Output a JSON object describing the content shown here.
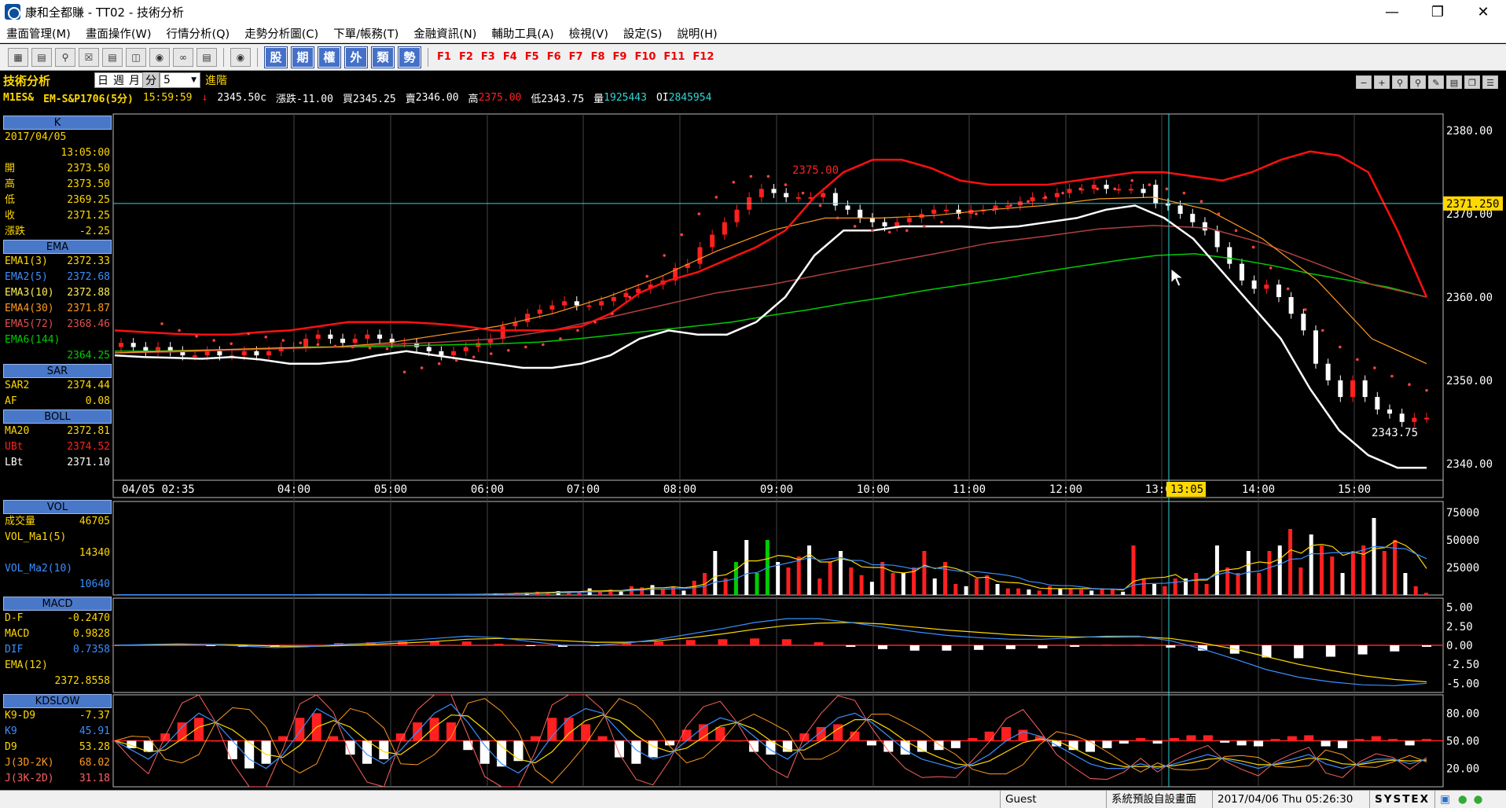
{
  "window": {
    "title": "康和全都賺 - TT02 - 技術分析"
  },
  "menu": [
    "畫面管理(M)",
    "畫面操作(W)",
    "行情分析(Q)",
    "走勢分析圖(C)",
    "下單/帳務(T)",
    "金融資訊(N)",
    "輔助工具(A)",
    "檢視(V)",
    "設定(S)",
    "說明(H)"
  ],
  "toolbar": {
    "kbuttons": [
      "股",
      "期",
      "權",
      "外",
      "類",
      "勢"
    ],
    "fkeys": [
      "F1",
      "F2",
      "F3",
      "F4",
      "F5",
      "F6",
      "F7",
      "F8",
      "F9",
      "F10",
      "F11",
      "F12"
    ]
  },
  "header": {
    "label": "技術分析",
    "periods": [
      "日",
      "週",
      "月",
      "分"
    ],
    "interval": "5",
    "advance": "進階"
  },
  "quote": {
    "symbol": "M1ES&",
    "name": "EM-S&P1706(5分)",
    "time": "15:59:59",
    "last": "2345.50c",
    "change": "漲跌-11.00",
    "bid": "買2345.25",
    "ask_label": "賣",
    "ask": "2346.00",
    "high_label": "高",
    "high": "2375.00",
    "low": "低2343.75",
    "vol_label": "量",
    "vol": "1925443",
    "oi_label": "OI",
    "oi": "2845954"
  },
  "panel": {
    "k": {
      "title": "K",
      "date": "2017/04/05",
      "time": "13:05:00",
      "rows": [
        [
          "開",
          "2373.50"
        ],
        [
          "高",
          "2373.50"
        ],
        [
          "低",
          "2369.25"
        ],
        [
          "收",
          "2371.25"
        ],
        [
          "漲跌",
          "-2.25"
        ]
      ]
    },
    "ema": {
      "title": "EMA",
      "rows": [
        [
          "EMA1(3)",
          "2372.33"
        ],
        [
          "EMA2(5)",
          "2372.68"
        ],
        [
          "EMA3(10)",
          "2372.88"
        ],
        [
          "EMA4(30)",
          "2371.87"
        ],
        [
          "EMA5(72)",
          "2368.46"
        ],
        [
          "EMA6(144)",
          ""
        ],
        [
          "",
          "2364.25"
        ]
      ]
    },
    "sar": {
      "title": "SAR",
      "rows": [
        [
          "SAR2",
          "2374.44"
        ],
        [
          "AF",
          "0.08"
        ]
      ]
    },
    "boll": {
      "title": "BOLL",
      "rows": [
        [
          "MA20",
          "2372.81"
        ],
        [
          "UBt",
          "2374.52"
        ],
        [
          "LBt",
          "2371.10"
        ]
      ]
    },
    "vol": {
      "title": "VOL",
      "rows": [
        [
          "成交量",
          "46705"
        ],
        [
          "VOL_Ma1(5)",
          ""
        ],
        [
          "",
          "14340"
        ],
        [
          "VOL_Ma2(10)",
          ""
        ],
        [
          "",
          "10640"
        ]
      ]
    },
    "macd": {
      "title": "MACD",
      "rows": [
        [
          "D-F",
          "-0.2470"
        ],
        [
          "MACD",
          "0.9828"
        ],
        [
          "DIF",
          "0.7358"
        ],
        [
          "EMA(12)",
          ""
        ],
        [
          "",
          "2372.8558"
        ]
      ]
    },
    "kd": {
      "title": "KDSLOW",
      "rows": [
        [
          "K9-D9",
          "-7.37"
        ],
        [
          "K9",
          "45.91"
        ],
        [
          "D9",
          "53.28"
        ],
        [
          "J(3D-2K)",
          "68.02"
        ],
        [
          "J(3K-2D)",
          "31.18"
        ]
      ]
    }
  },
  "status": {
    "user": "Guest",
    "screen": "系統預設自設畫面",
    "datetime": "2017/04/06 Thu 05:26:30",
    "brand": "SYSTEX"
  },
  "colors": {
    "up": "#ff2020",
    "down": "#ffffff",
    "ema1": "#ffd800",
    "ema2": "#3a8fff",
    "ema3": "#ffee55",
    "ema4": "#ff9a20",
    "ema5": "#b04040",
    "ema6": "#00cc00",
    "sar": "#ff4040",
    "ub": "#ff1010",
    "lb": "#ffffff"
  },
  "chart_data": {
    "type": "line",
    "xticks": [
      "04/05 02:35",
      "04:00",
      "05:00",
      "06:00",
      "07:00",
      "08:00",
      "09:00",
      "10:00",
      "11:00",
      "12:00",
      "13:00",
      "14:00",
      "15:00"
    ],
    "price_ticks": [
      2380,
      2370,
      2360,
      2350,
      2340
    ],
    "ylim": [
      2338,
      2382
    ],
    "crosshair": {
      "time": "13:05",
      "price_label": "2371.250",
      "price": 2371.25
    },
    "annotations": [
      {
        "text": "2375.00",
        "price": 2375.0
      },
      {
        "text": "2343.75",
        "price": 2343.75
      }
    ],
    "price_close": [
      2354.5,
      2354.0,
      2353.5,
      2354.0,
      2353.5,
      2353.0,
      2353.0,
      2353.5,
      2353.0,
      2353.0,
      2353.5,
      2353.0,
      2353.5,
      2354.0,
      2354.0,
      2355.0,
      2355.5,
      2355.0,
      2354.5,
      2355.0,
      2355.5,
      2355.0,
      2354.5,
      2354.5,
      2354.0,
      2353.5,
      2353.0,
      2353.5,
      2354.0,
      2354.5,
      2355.0,
      2356.5,
      2357.0,
      2358.0,
      2358.5,
      2359.0,
      2359.5,
      2359.0,
      2359.0,
      2359.5,
      2360.0,
      2360.5,
      2361.0,
      2361.5,
      2362.0,
      2363.5,
      2364.0,
      2366.0,
      2367.5,
      2369.0,
      2370.5,
      2372.0,
      2373.0,
      2372.5,
      2372.0,
      2372.0,
      2372.0,
      2372.5,
      2371.0,
      2370.5,
      2369.5,
      2369.0,
      2368.5,
      2369.0,
      2369.5,
      2370.0,
      2370.5,
      2370.5,
      2370.0,
      2370.5,
      2370.5,
      2371.0,
      2371.0,
      2371.5,
      2372.0,
      2372.0,
      2372.5,
      2373.0,
      2373.0,
      2373.5,
      2373.0,
      2373.0,
      2373.0,
      2372.5,
      2371.25,
      2371.0,
      2370.0,
      2369.0,
      2368.0,
      2366.0,
      2364.0,
      2362.0,
      2361.0,
      2361.5,
      2360.0,
      2358.0,
      2356.0,
      2352.0,
      2350.0,
      2348.0,
      2350.0,
      2348.0,
      2346.5,
      2346.0,
      2345.0,
      2345.5,
      2345.5
    ],
    "price_open": [
      2354.0,
      2354.5,
      2354.0,
      2353.5,
      2354.0,
      2353.5,
      2353.0,
      2353.0,
      2353.5,
      2353.0,
      2353.0,
      2353.5,
      2353.0,
      2353.5,
      2354.0,
      2354.0,
      2355.0,
      2355.5,
      2355.0,
      2354.5,
      2355.0,
      2355.5,
      2355.0,
      2354.5,
      2354.5,
      2354.0,
      2353.5,
      2353.0,
      2353.5,
      2354.0,
      2354.5,
      2355.0,
      2356.5,
      2357.0,
      2358.0,
      2358.5,
      2359.0,
      2359.5,
      2359.0,
      2359.0,
      2359.5,
      2360.0,
      2360.5,
      2361.0,
      2361.5,
      2362.0,
      2363.5,
      2364.0,
      2366.0,
      2367.5,
      2369.0,
      2370.5,
      2372.0,
      2373.0,
      2372.5,
      2372.0,
      2372.0,
      2372.0,
      2372.5,
      2371.0,
      2370.5,
      2369.5,
      2369.0,
      2368.5,
      2369.0,
      2369.5,
      2370.0,
      2370.5,
      2370.5,
      2370.0,
      2370.5,
      2370.5,
      2371.0,
      2371.0,
      2371.5,
      2372.0,
      2372.0,
      2372.5,
      2373.0,
      2373.0,
      2373.5,
      2373.0,
      2373.0,
      2373.0,
      2373.5,
      2371.25,
      2371.0,
      2370.0,
      2369.0,
      2368.0,
      2366.0,
      2364.0,
      2362.0,
      2361.0,
      2361.5,
      2360.0,
      2358.0,
      2356.0,
      2352.0,
      2350.0,
      2348.0,
      2350.0,
      2348.0,
      2346.5,
      2346.0,
      2345.0,
      2345.5
    ],
    "ub": [
      2356.0,
      2355.8,
      2355.6,
      2355.5,
      2355.5,
      2355.8,
      2356.0,
      2356.5,
      2357.0,
      2357.0,
      2357.0,
      2356.8,
      2356.5,
      2356.0,
      2356.0,
      2356.0,
      2356.5,
      2358.0,
      2360.5,
      2362.0,
      2363.0,
      2364.5,
      2366.0,
      2368.0,
      2372.0,
      2375.0,
      2376.5,
      2376.5,
      2375.5,
      2374.0,
      2373.5,
      2373.5,
      2373.5,
      2374.0,
      2374.5,
      2375.0,
      2375.0,
      2374.5,
      2374.0,
      2375.0,
      2376.5,
      2377.5,
      2377.0,
      2375.0,
      2368.0,
      2360.0
    ],
    "lb": [
      2353.0,
      2352.8,
      2352.7,
      2352.6,
      2352.8,
      2352.5,
      2352.0,
      2352.0,
      2352.3,
      2353.0,
      2353.5,
      2353.0,
      2352.5,
      2352.0,
      2351.5,
      2351.5,
      2352.0,
      2353.0,
      2355.0,
      2356.0,
      2355.5,
      2355.5,
      2357.0,
      2360.0,
      2365.0,
      2368.0,
      2368.0,
      2368.5,
      2368.5,
      2368.5,
      2368.3,
      2368.5,
      2369.0,
      2369.5,
      2370.5,
      2371.0,
      2369.5,
      2367.0,
      2363.0,
      2359.0,
      2355.0,
      2349.0,
      2344.0,
      2341.0,
      2339.5,
      2339.5
    ],
    "ema6": [
      2353.5,
      2353.5,
      2353.6,
      2353.7,
      2353.8,
      2354.0,
      2354.0,
      2354.1,
      2354.2,
      2354.3,
      2354.4,
      2354.6,
      2355.0,
      2355.5,
      2356.0,
      2356.5,
      2357.0,
      2357.8,
      2358.5,
      2359.3,
      2360.0,
      2360.8,
      2361.5,
      2362.2,
      2363.0,
      2363.7,
      2364.4,
      2365.0,
      2365.2,
      2364.6,
      2363.8,
      2362.8,
      2362.0,
      2361.2,
      2360.0
    ],
    "ema5": [
      2353.3,
      2353.4,
      2353.6,
      2353.8,
      2354.0,
      2354.3,
      2354.6,
      2355.0,
      2356.0,
      2357.5,
      2359.0,
      2360.5,
      2361.5,
      2362.8,
      2364.0,
      2365.2,
      2366.5,
      2367.3,
      2368.2,
      2368.6,
      2368.3,
      2366.5,
      2364.0,
      2361.5,
      2360.0
    ],
    "ema4": [
      2353.3,
      2353.5,
      2353.7,
      2353.9,
      2354.0,
      2354.5,
      2355.5,
      2356.5,
      2358.0,
      2360.0,
      2362.5,
      2365.5,
      2368.0,
      2369.5,
      2369.5,
      2369.8,
      2370.5,
      2371.0,
      2371.8,
      2372.0,
      2370.5,
      2367.0,
      2362.0,
      2355.0,
      2352.0
    ],
    "sar": [
      2356.8,
      2356.0,
      2355.3,
      2354.8,
      2354.4,
      2355.6,
      2355.2,
      2354.8,
      2354.5,
      2354.3,
      2354.1,
      2354.0,
      2353.9,
      2353.8,
      2351.0,
      2351.5,
      2352.0,
      2352.4,
      2352.8,
      2353.2,
      2353.6,
      2354.0,
      2354.3,
      2355.0,
      2356.0,
      2357.0,
      2358.0,
      2360.0,
      2362.5,
      2365.0,
      2367.5,
      2370.0,
      2372.0,
      2373.8,
      2374.5,
      2374.5,
      2373.5,
      2372.5,
      2371.0,
      2369.5,
      2368.5,
      2368.0,
      2367.8,
      2368.0,
      2368.5,
      2369.0,
      2369.5,
      2370.0,
      2370.5,
      2371.0,
      2371.5,
      2372.0,
      2372.5,
      2373.0,
      2373.0,
      2373.0,
      2374.0,
      2373.5,
      2373.0,
      2372.5,
      2371.5,
      2370.0,
      2368.0,
      2366.0,
      2363.5,
      2361.0,
      2358.5,
      2356.0,
      2354.0,
      2352.5,
      2351.5,
      2350.5,
      2349.5,
      2348.8
    ],
    "vol_values": [
      300,
      300,
      250,
      300,
      250,
      250,
      300,
      250,
      300,
      300,
      300,
      300,
      350,
      300,
      300,
      300,
      300,
      350,
      350,
      400,
      350,
      300,
      300,
      350,
      300,
      300,
      400,
      350,
      300,
      350,
      500,
      400,
      600,
      500,
      800,
      1200,
      1500,
      1400,
      2000,
      2200,
      3000,
      2800,
      3500,
      3200,
      3000,
      6000,
      3000,
      5000,
      3500,
      8000,
      7000,
      9000,
      5000,
      8000,
      4000,
      13000,
      20000,
      40000,
      15000,
      30000,
      50000,
      20000,
      50000,
      30000,
      25000,
      35000,
      45000,
      15000,
      30000,
      40000,
      25000,
      18000,
      12000,
      30000,
      20000,
      20000,
      25000,
      40000,
      15000,
      30000,
      10000,
      8000,
      15000,
      18000,
      10000,
      6000,
      6000,
      5000,
      4000,
      8000,
      6000,
      6000,
      5000,
      4000,
      6000,
      5000,
      3000,
      45000,
      15000,
      10000,
      8000,
      15000,
      15000,
      20000,
      10000,
      45000,
      25000,
      20000,
      40000,
      20000,
      40000,
      45000,
      60000,
      25000,
      55000,
      45000,
      35000,
      20000,
      40000,
      45000,
      70000,
      40000,
      50000,
      20000,
      8000,
      2000
    ],
    "vol_ticks": [
      75000,
      50000,
      25000
    ],
    "macd_ticks": [
      5.0,
      2.5,
      0.0,
      -2.5,
      -5.0
    ],
    "macd_dif": [
      0.0,
      0.1,
      0.2,
      0.1,
      -0.1,
      -0.3,
      -0.2,
      0.1,
      0.3,
      0.6,
      0.9,
      1.2,
      1.0,
      0.5,
      0.0,
      0.0,
      0.3,
      0.8,
      1.5,
      2.2,
      3.0,
      3.5,
      3.5,
      3.0,
      2.4,
      1.8,
      1.3,
      1.0,
      0.8,
      0.8,
      1.0,
      1.2,
      1.2,
      0.6,
      -0.5,
      -1.8,
      -3.2,
      -4.2,
      -4.8,
      -5.2,
      -5.3,
      -5.0
    ],
    "macd_ema": [
      0.0,
      0.05,
      0.1,
      0.12,
      0.05,
      -0.1,
      -0.15,
      -0.05,
      0.1,
      0.3,
      0.5,
      0.8,
      0.9,
      0.8,
      0.6,
      0.4,
      0.4,
      0.6,
      1.0,
      1.5,
      2.1,
      2.6,
      2.9,
      3.0,
      2.8,
      2.4,
      2.0,
      1.7,
      1.4,
      1.2,
      1.1,
      1.1,
      1.15,
      0.9,
      0.3,
      -0.5,
      -1.5,
      -2.5,
      -3.3,
      -4.0,
      -4.5,
      -4.8
    ],
    "macd_bars": [
      0.0,
      0.1,
      0.1,
      -0.1,
      -0.2,
      -0.2,
      0.0,
      0.3,
      0.4,
      0.5,
      0.5,
      0.5,
      0.2,
      -0.1,
      -0.2,
      -0.1,
      0.3,
      0.5,
      0.7,
      0.8,
      0.9,
      0.8,
      0.4,
      -0.2,
      -0.5,
      -0.7,
      -0.7,
      -0.6,
      -0.5,
      -0.4,
      -0.2,
      0.1,
      0.1,
      -0.3,
      -0.7,
      -1.1,
      -1.6,
      -1.7,
      -1.5,
      -1.2,
      -0.8,
      -0.2
    ],
    "kd_ticks": [
      80.0,
      50.0,
      20.0
    ],
    "kd_k": [
      50,
      40,
      30,
      45,
      65,
      80,
      70,
      50,
      30,
      20,
      35,
      60,
      85,
      75,
      55,
      35,
      25,
      40,
      60,
      80,
      90,
      70,
      45,
      25,
      15,
      30,
      55,
      75,
      85,
      80,
      60,
      40,
      30,
      35,
      50,
      65,
      75,
      70,
      55,
      40,
      30,
      45,
      60,
      75,
      80,
      70,
      55,
      40,
      30,
      25,
      20,
      25,
      35,
      50,
      60,
      55,
      45,
      35,
      25,
      20,
      20,
      25,
      20,
      25,
      30,
      35,
      30,
      25,
      20,
      25,
      30,
      35,
      25,
      20,
      25,
      30,
      30,
      25,
      30
    ],
    "kd_d": [
      50,
      45,
      38,
      40,
      52,
      65,
      70,
      62,
      48,
      35,
      32,
      45,
      65,
      72,
      65,
      50,
      38,
      35,
      48,
      65,
      78,
      77,
      62,
      44,
      30,
      26,
      38,
      58,
      72,
      78,
      72,
      56,
      44,
      38,
      42,
      54,
      66,
      70,
      63,
      50,
      40,
      40,
      50,
      63,
      73,
      73,
      63,
      50,
      40,
      32,
      25,
      23,
      28,
      38,
      48,
      52,
      50,
      42,
      33,
      26,
      22,
      22,
      22,
      23,
      26,
      30,
      31,
      28,
      24,
      24,
      27,
      31,
      30,
      25,
      24,
      27,
      29,
      28,
      29
    ],
    "kd_bars": [
      0,
      -8,
      -12,
      8,
      20,
      25,
      0,
      -20,
      -30,
      -25,
      5,
      25,
      30,
      5,
      -15,
      -25,
      -20,
      8,
      20,
      25,
      20,
      -10,
      -25,
      -28,
      -22,
      5,
      25,
      25,
      18,
      5,
      -18,
      -25,
      -18,
      -5,
      12,
      18,
      15,
      0,
      -12,
      -15,
      -12,
      8,
      15,
      18,
      10,
      -5,
      -12,
      -15,
      -12,
      -10,
      -8,
      3,
      10,
      15,
      12,
      5,
      -6,
      -10,
      -12,
      -8,
      -3,
      3,
      -3,
      3,
      6,
      6,
      -2,
      -5,
      -6,
      2,
      5,
      6,
      -6,
      -8,
      2,
      5,
      2,
      -5,
      2
    ]
  }
}
